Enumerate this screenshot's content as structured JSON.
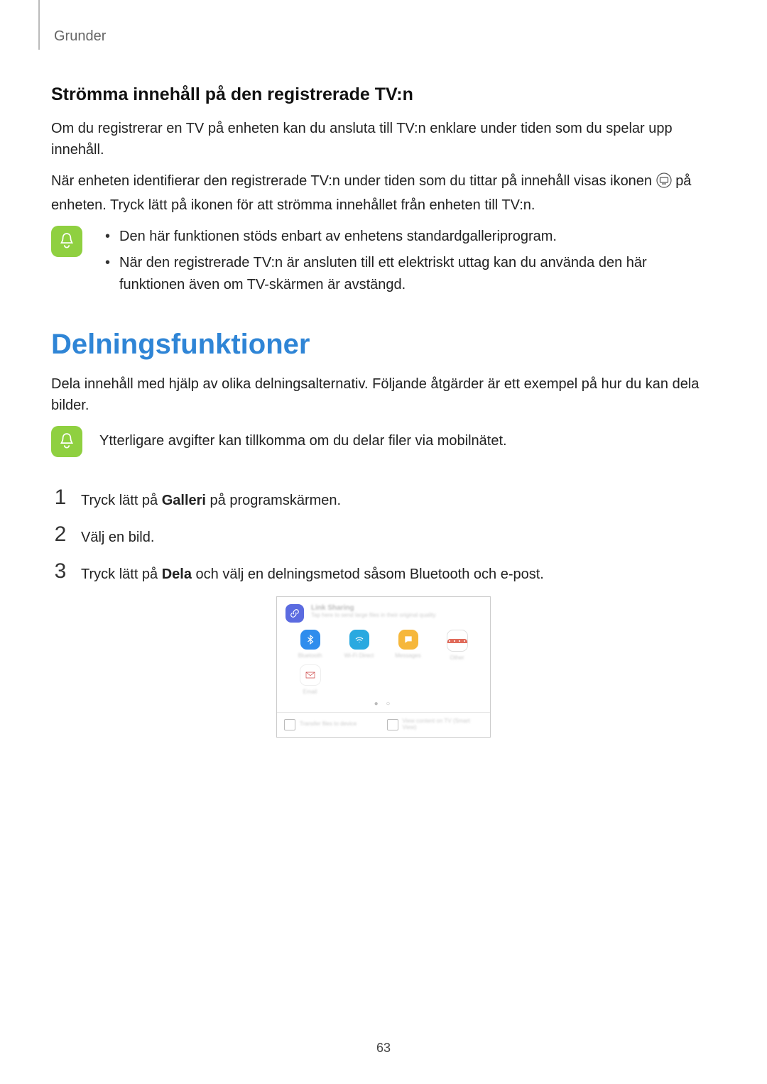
{
  "header": {
    "section": "Grunder"
  },
  "sub_heading": "Strömma innehåll på den registrerade TV:n",
  "para1": "Om du registrerar en TV på enheten kan du ansluta till TV:n enklare under tiden som du spelar upp innehåll.",
  "para2_a": "När enheten identifierar den registrerade TV:n under tiden som du tittar på innehåll visas ikonen ",
  "para2_b": " på enheten. Tryck lätt på ikonen för att strömma innehållet från enheten till TV:n.",
  "note1": {
    "bullets": [
      "Den här funktionen stöds enbart av enhetens standardgalleriprogram.",
      "När den registrerade TV:n är ansluten till ett elektriskt uttag kan du använda den här funktionen även om TV-skärmen är avstängd."
    ]
  },
  "main_heading": "Delningsfunktioner",
  "para3": "Dela innehåll med hjälp av olika delningsalternativ. Följande åtgärder är ett exempel på hur du kan dela bilder.",
  "note2": {
    "text": "Ytterligare avgifter kan tillkomma om du delar filer via mobilnätet."
  },
  "steps": [
    {
      "num": "1",
      "pre": "Tryck lätt på ",
      "bold": "Galleri",
      "post": " på programskärmen."
    },
    {
      "num": "2",
      "pre": "Välj en bild.",
      "bold": "",
      "post": ""
    },
    {
      "num": "3",
      "pre": "Tryck lätt på ",
      "bold": "Dela",
      "post": " och välj en delningsmetod såsom Bluetooth och e-post."
    }
  ],
  "share_panel": {
    "top_title": "Link Sharing",
    "top_sub": "Tap here to send large files in their original quality",
    "icons": [
      {
        "name": "bluetooth-icon",
        "label": "Bluetooth"
      },
      {
        "name": "wifi-direct-icon",
        "label": "Wi-Fi Direct"
      },
      {
        "name": "messages-icon",
        "label": "Messages"
      },
      {
        "name": "calendar-icon",
        "label": "Other"
      },
      {
        "name": "email-icon",
        "label": "Email"
      }
    ],
    "bottom": [
      {
        "label": "Transfer files to device"
      },
      {
        "label": "View content on TV (Smart View)"
      }
    ]
  },
  "page_number": "63"
}
